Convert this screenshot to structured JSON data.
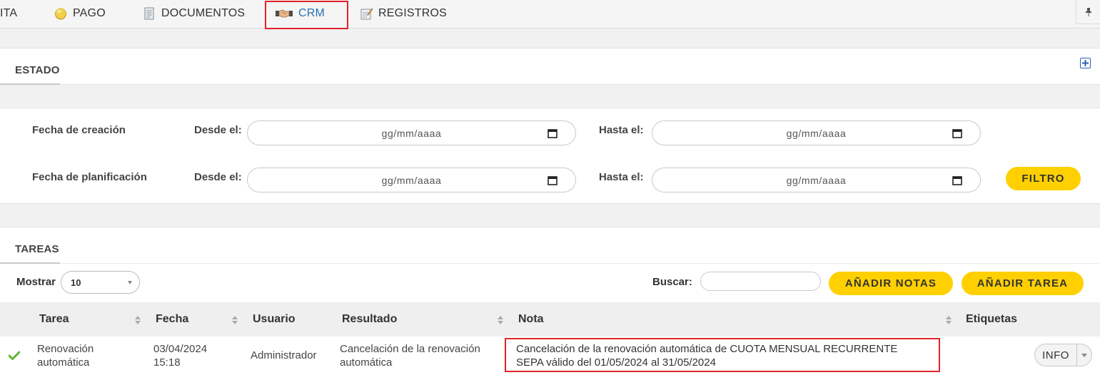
{
  "nav": {
    "items": [
      {
        "label": "ITA",
        "icon": "none"
      },
      {
        "label": "PAGO",
        "icon": "coin-icon"
      },
      {
        "label": "DOCUMENTOS",
        "icon": "document-icon"
      },
      {
        "label": "CRM",
        "icon": "handshake-icon"
      },
      {
        "label": "REGISTROS",
        "icon": "notepad-icon"
      }
    ],
    "active": "CRM",
    "pin_icon": "pin-icon"
  },
  "estado": {
    "title": "ESTADO",
    "expand_icon": "plus-icon"
  },
  "filter": {
    "rows": [
      {
        "label": "Fecha de creación",
        "from_label": "Desde el:",
        "from_placeholder": "gg/mm/aaaa",
        "to_label": "Hasta el:",
        "to_placeholder": "gg/mm/aaaa"
      },
      {
        "label": "Fecha de planificación",
        "from_label": "Desde el:",
        "from_placeholder": "gg/mm/aaaa",
        "to_label": "Hasta el:",
        "to_placeholder": "gg/mm/aaaa"
      }
    ],
    "button_label": "FILTRO"
  },
  "tasks": {
    "title": "TAREAS",
    "show_label": "Mostrar",
    "show_value": "10",
    "search_label": "Buscar:",
    "search_value": "",
    "add_notes_label": "AÑADIR NOTAS",
    "add_task_label": "AÑADIR TAREA",
    "columns": [
      "Tarea",
      "Fecha",
      "Usuario",
      "Resultado",
      "Nota",
      "Etiquetas"
    ],
    "rows": [
      {
        "status_icon": "checkmark-icon",
        "task_line1": "Renovación",
        "task_line2": "automática",
        "date_line1": "03/04/2024",
        "date_line2": "15:18",
        "user": "Administrador",
        "result_line1": "Cancelación de la renovación",
        "result_line2": "automática",
        "note_line1": "Cancelación de la renovación automática de CUOTA MENSUAL RECURRENTE",
        "note_line2": "SEPA válido del 01/05/2024 al 31/05/2024",
        "tag_label": "INFO"
      }
    ]
  },
  "colors": {
    "accent_yellow": "#ffd000",
    "highlight_red": "#e0242a",
    "active_blue": "#2a6fb5",
    "check_green": "#5cb531"
  }
}
